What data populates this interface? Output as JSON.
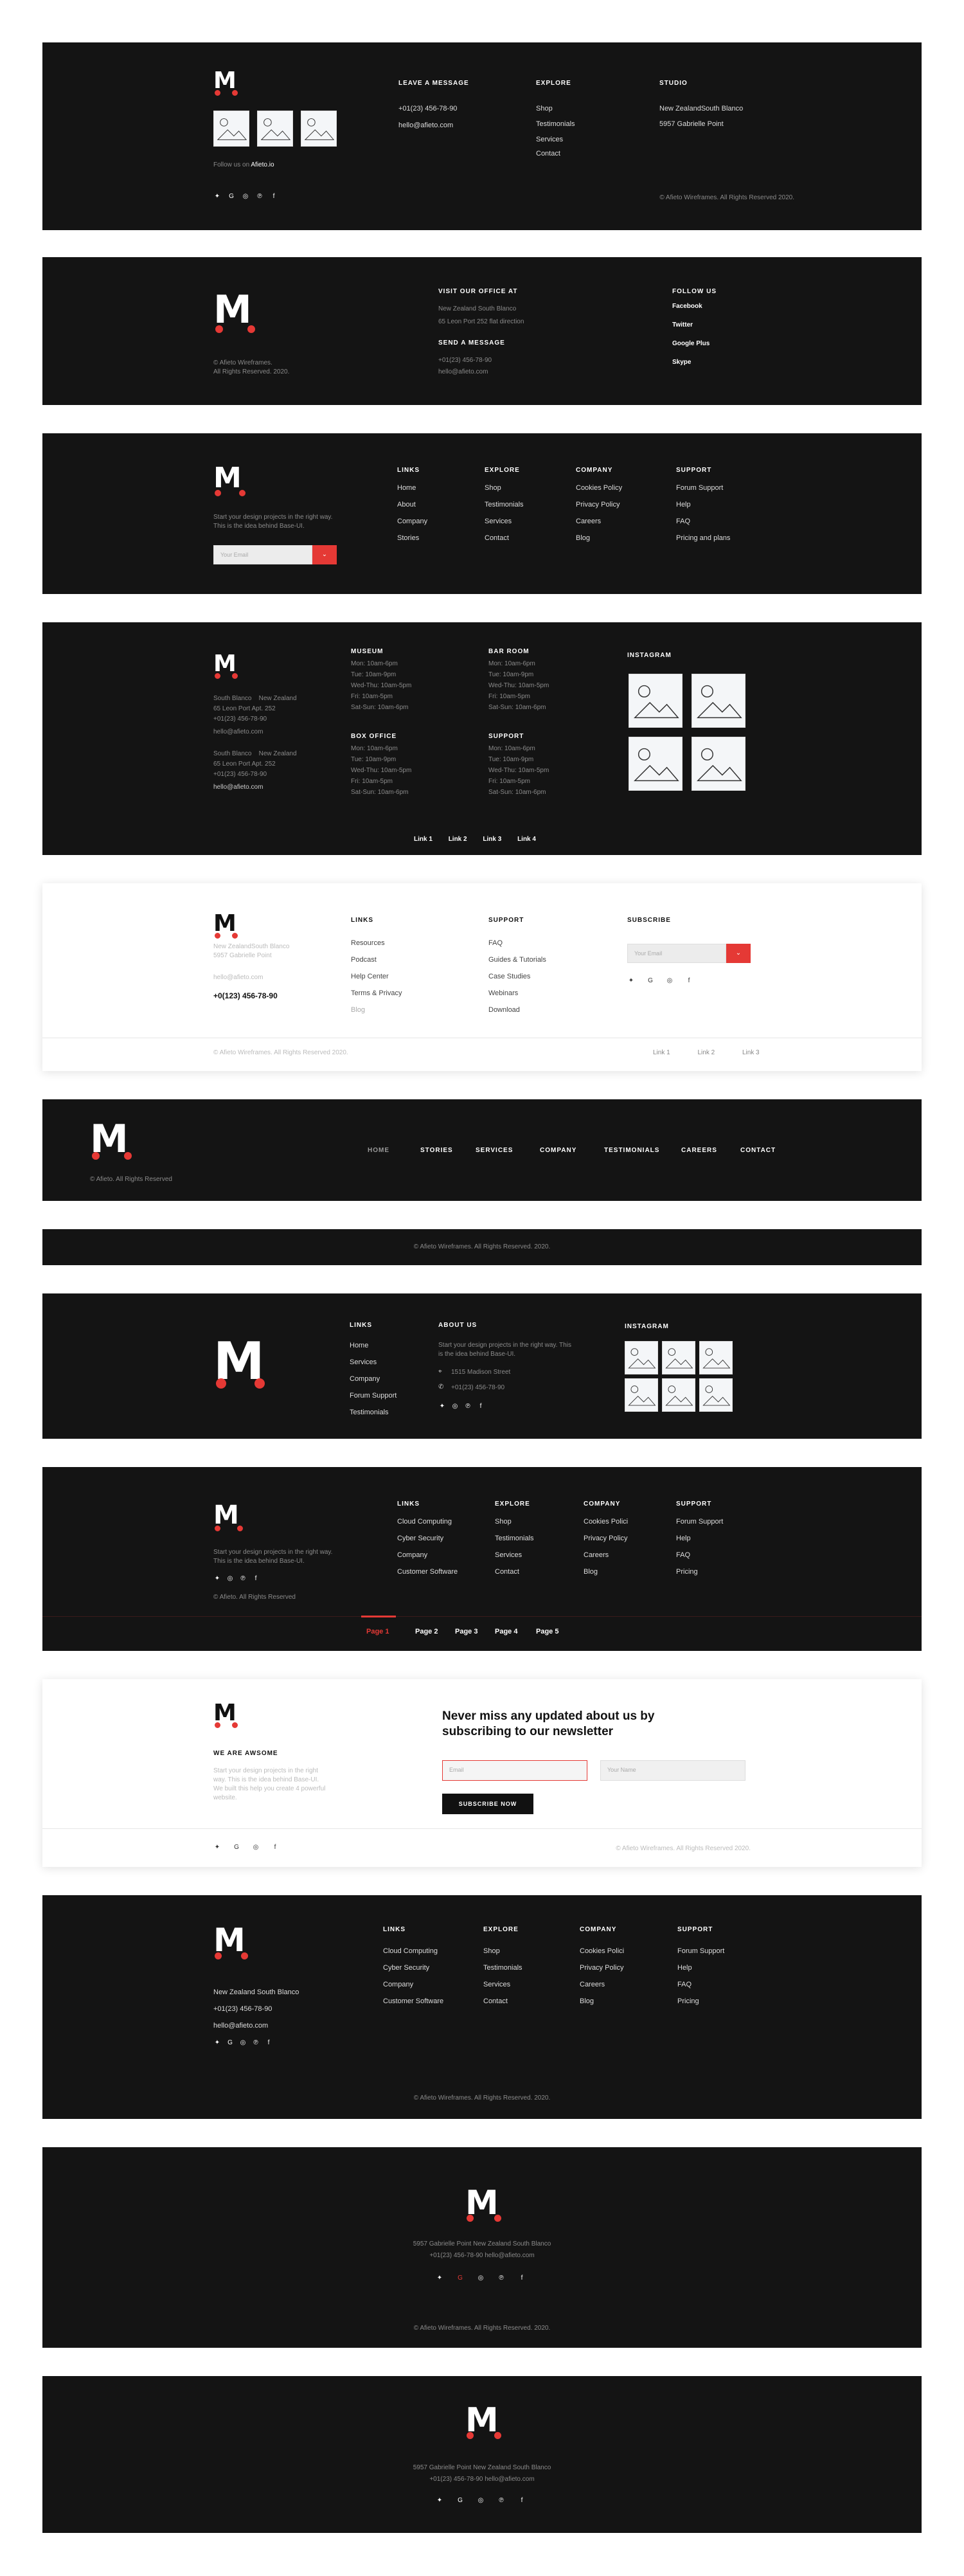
{
  "brand": {
    "letter": "M",
    "accent": "#e53935"
  },
  "icons": [
    "twitter-icon",
    "google-icon",
    "instagram-icon",
    "pinterest-icon",
    "facebook-icon"
  ],
  "s1": {
    "heading_msg": "LEAVE A MESSAGE",
    "phone": "+01(23) 456-78-90",
    "email": "hello@afieto.com",
    "heading_explore": "EXPLORE",
    "explore": [
      "Shop",
      "Testimonials",
      "Services",
      "Contact"
    ],
    "heading_studio": "STUDIO",
    "studio": "New ZealandSouth Blanco",
    "studio2": "5957 Gabrielle Point",
    "follow": "Follow us on",
    "follow_link": "Afieto.io",
    "copyright": "© Afieto Wireframes. All Rights Reserved 2020."
  },
  "s2": {
    "copy1": "© Afieto Wireframes.",
    "copy2": "All Rights Reserved. 2020.",
    "h_visit": "VISIT OUR OFFICE AT",
    "addr1": "New Zealand   South Blanco",
    "addr2": "65 Leon Port  252  flat direction",
    "h_send": "SEND A MESSAGE",
    "phone": "+01(23) 456-78-90",
    "email": "hello@afieto.com",
    "h_follow": "FOLLOW US",
    "follow": [
      "Facebook",
      "Twitter",
      "Google Plus",
      "Skype"
    ]
  },
  "s3": {
    "desc": "Start your design projects in the right way. This is the idea behind Base-UI.",
    "email_ph": "Your Email",
    "cols": [
      {
        "h": "LINKS",
        "items": [
          "Home",
          "About",
          "Company",
          "Stories"
        ]
      },
      {
        "h": "EXPLORE",
        "items": [
          "Shop",
          "Testimonials",
          "Services",
          "Contact"
        ]
      },
      {
        "h": "COMPANY",
        "items": [
          "Cookies Policy",
          "Privacy Policy",
          "Careers",
          "Blog"
        ]
      },
      {
        "h": "SUPPORT",
        "items": [
          "Forum Support",
          "Help",
          "FAQ",
          "Pricing and plans"
        ]
      }
    ]
  },
  "s4": {
    "addr1a": "South Blanco",
    "addr1b": "New Zealand",
    "addr1c": "65 Leon Port Apt. 252",
    "phone1": "+01(23) 456-78-90",
    "email1": "hello@afieto.com",
    "addr2a": "South Blanco",
    "addr2b": "New Zealand",
    "addr2c": "65 Leon Port Apt. 252",
    "phone2": "+01(23) 456-78-90",
    "email2": "hello@afieto.com",
    "hours": [
      {
        "h": "MUSEUM",
        "items": [
          "Mon:  10am-6pm",
          "Tue:  10am-9pm",
          "Wed-Thu: 10am-5pm",
          "Fri: 10am-5pm",
          "Sat-Sun:  10am-6pm"
        ]
      },
      {
        "h": "BAR ROOM",
        "items": [
          "Mon:  10am-6pm",
          "Tue:  10am-9pm",
          "Wed-Thu: 10am-5pm",
          "Fri: 10am-5pm",
          "Sat-Sun:  10am-6pm"
        ]
      },
      {
        "h": "BOX OFFICE",
        "items": [
          "Mon:  10am-6pm",
          "Tue:  10am-9pm",
          "Wed-Thu: 10am-5pm",
          "Fri: 10am-5pm",
          "Sat-Sun:  10am-6pm"
        ]
      },
      {
        "h": "SUPPORT",
        "items": [
          "Mon:  10am-6pm",
          "Tue:  10am-9pm",
          "Wed-Thu: 10am-5pm",
          "Fri: 10am-5pm",
          "Sat-Sun:  10am-6pm"
        ]
      }
    ],
    "h_insta": "INSTAGRAM",
    "links": [
      "Link 1",
      "Link 2",
      "Link 3",
      "Link 4"
    ]
  },
  "s5": {
    "addr": "New ZealandSouth Blanco",
    "addr2": "5957 Gabrielle Point",
    "email": "hello@afieto.com",
    "phone": "+0(123) 456-78-90",
    "h_links": "LINKS",
    "links": [
      "Resources",
      "Podcast",
      "Help Center",
      "Terms & Privacy",
      "Blog"
    ],
    "h_support": "SUPPORT",
    "support": [
      "FAQ",
      "Guides & Tutorials",
      "Case Studies",
      "Webinars",
      "Download"
    ],
    "h_sub": "SUBSCRIBE",
    "email_ph": "Your Email",
    "copyright": "© Afieto Wireframes. All Rights Reserved 2020.",
    "bottom": [
      "Link 1",
      "Link 2",
      "Link 3"
    ]
  },
  "s6": {
    "copyright": "© Afieto. All Rights Reserved",
    "nav": [
      "HOME",
      "STORIES",
      "SERVICES",
      "COMPANY",
      "TESTIMONIALS",
      "CAREERS",
      "CONTACT"
    ]
  },
  "s7": {
    "copyright": "© Afieto Wireframes. All Rights Reserved. 2020."
  },
  "s8": {
    "h_links": "LINKS",
    "links": [
      "Home",
      "Services",
      "Company",
      "Forum Support",
      "Testimonials"
    ],
    "h_about": "ABOUT US",
    "about": "Start your design projects in the right way. This is the idea behind Base-UI.",
    "addr": "1515 Madison Street",
    "phone": "+01(23) 456-78-90",
    "h_insta": "INSTAGRAM"
  },
  "s9": {
    "desc": "Start your design projects in the right way. This is the idea behind Base-UI.",
    "copyright": "© Afieto. All Rights Reserved",
    "cols": [
      {
        "h": "LINKS",
        "items": [
          "Cloud Computing",
          "Cyber Security",
          "Company",
          "Customer Software"
        ]
      },
      {
        "h": "EXPLORE",
        "items": [
          "Shop",
          "Testimonials",
          "Services",
          "Contact"
        ]
      },
      {
        "h": "COMPANY",
        "items": [
          "Cookies Polici",
          "Privacy Policy",
          "Careers",
          "Blog"
        ]
      },
      {
        "h": "SUPPORT",
        "items": [
          "Forum Support",
          "Help",
          "FAQ",
          "Pricing"
        ]
      }
    ],
    "pages": [
      "Page 1",
      "Page 2",
      "Page 3",
      "Page 4",
      "Page 5"
    ]
  },
  "s10": {
    "h_aw": "WE ARE AWSOME",
    "desc": "Start your design projects in the right way. This is the idea behind Base-UI. We built this help you create 4 powerful website.",
    "title": "Never miss any updated about us by subscribing to our  newsletter",
    "email_ph": "Email",
    "name_ph": "Your Name",
    "btn": "SUBSCRIBE NOW",
    "copyright": "© Afieto Wireframes. All Rights Reserved 2020."
  },
  "s11": {
    "addr": "New Zealand  South Blanco",
    "phone": "+01(23) 456-78-90",
    "email": "hello@afieto.com",
    "copyright": "© Afieto Wireframes. All Rights Reserved. 2020.",
    "cols": [
      {
        "h": "LINKS",
        "items": [
          "Cloud Computing",
          "Cyber Security",
          "Company",
          "Customer Software"
        ]
      },
      {
        "h": "EXPLORE",
        "items": [
          "Shop",
          "Testimonials",
          "Services",
          "Contact"
        ]
      },
      {
        "h": "COMPANY",
        "items": [
          "Cookies Polici",
          "Privacy Policy",
          "Careers",
          "Blog"
        ]
      },
      {
        "h": "SUPPORT",
        "items": [
          "Forum Support",
          "Help",
          "FAQ",
          "Pricing"
        ]
      }
    ]
  },
  "s12": {
    "addr": "5957 Gabrielle Point   New Zealand South Blanco",
    "contact": "+01(23) 456-78-90  hello@afieto.com",
    "copyright": "© Afieto Wireframes. All Rights Reserved. 2020."
  },
  "s13": {
    "addr": "5957 Gabrielle Point   New Zealand South Blanco",
    "contact": "+01(23) 456-78-90  hello@afieto.com"
  }
}
